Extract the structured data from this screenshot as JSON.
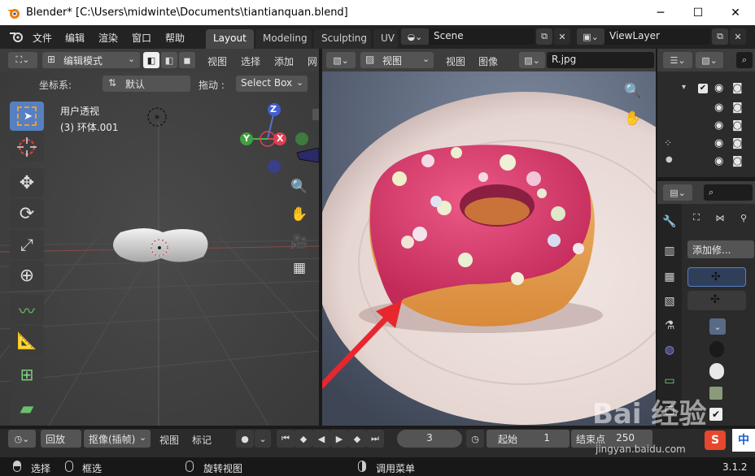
{
  "title": "Blender* [C:\\Users\\midwinte\\Documents\\tiantianquan.blend]",
  "window": {
    "minimize": "─",
    "maximize": "☐",
    "close": "✕"
  },
  "menu": [
    "文件",
    "编辑",
    "渲染",
    "窗口",
    "帮助"
  ],
  "workspaces": [
    {
      "label": "Layout",
      "active": true
    },
    {
      "label": "Modeling",
      "active": false
    },
    {
      "label": "Sculpting",
      "active": false
    },
    {
      "label": "UV",
      "active": false
    }
  ],
  "scene": "Scene",
  "view_layer": "ViewLayer",
  "viewport": {
    "mode": "编辑模式",
    "menus": [
      "视图",
      "选择",
      "添加",
      "网"
    ],
    "coord_label": "坐标系:",
    "coord_value": "默认",
    "drag_label": "拖动 :",
    "drag_value": "Select Box",
    "overlay_line1": "用户透视",
    "overlay_line2": "(3) 环体.001",
    "gizmo": {
      "z": "Z",
      "x": "X",
      "y": "Y"
    }
  },
  "image_editor": {
    "view_dropdown": "视图",
    "menus": [
      "视图",
      "图像"
    ],
    "image_name": "R.jpg"
  },
  "properties": {
    "add_modifier": "添加修..."
  },
  "timeline": {
    "playback": "回放",
    "keying": "抠像(插帧)",
    "view": "视图",
    "marker": "标记",
    "current_frame": "3",
    "start_label": "起始",
    "start_value": "1",
    "end_label": "结束点",
    "end_value": "250"
  },
  "status": {
    "select": "选择",
    "box_select": "框选",
    "rotate": "旋转视图",
    "menu": "调用菜单",
    "version": "3.1.2"
  },
  "watermark": {
    "brand": "Bai 经验",
    "url": "jingyan.baidu.com",
    "ime": "中"
  },
  "colors": {
    "accent": "#5680c2",
    "glaze": "#d9416e",
    "arrow": "#e8262e"
  }
}
